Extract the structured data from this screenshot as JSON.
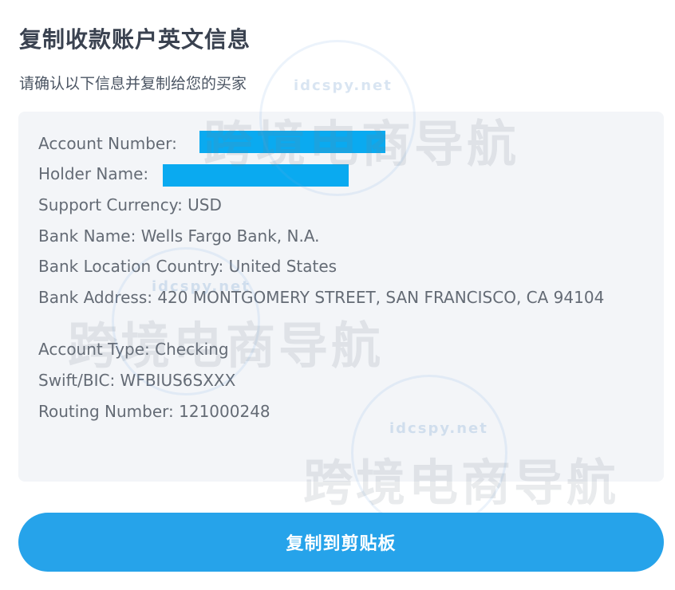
{
  "header": {
    "title": "复制收款账户英文信息",
    "subtitle": "请确认以下信息并复制给您的买家"
  },
  "account_info": {
    "account_number_label": "Account Number:",
    "holder_name_label": "Holder Name:",
    "support_currency": "Support Currency: USD",
    "bank_name": "Bank Name: Wells Fargo Bank, N.A.",
    "bank_location": "Bank Location Country: United States",
    "bank_address": "Bank Address: 420 MONTGOMERY STREET, SAN FRANCISCO, CA 94104",
    "account_type": "Account Type: Checking",
    "swift_bic": "Swift/BIC: WFBIUS6SXXX",
    "routing_number": "Routing Number: 121000248"
  },
  "watermark": {
    "url": "idcspy.net",
    "text": "跨境电商导航"
  },
  "actions": {
    "copy_label": "复制到剪贴板"
  },
  "colors": {
    "accent": "#26a3ea",
    "redaction": "#0aaaf0",
    "panel_bg": "#f3f5f8"
  }
}
